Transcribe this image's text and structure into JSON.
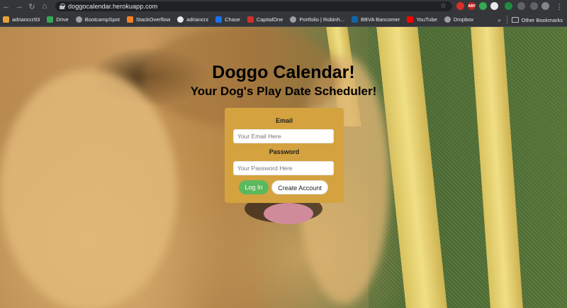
{
  "browser": {
    "url": "doggocalendar.herokuapp.com",
    "bookmarks": [
      {
        "label": "adriancrz93",
        "color": "#e8a23a"
      },
      {
        "label": "Drive",
        "color": "#34a853"
      },
      {
        "label": "BootcampSpot",
        "color": "#9aa0a6"
      },
      {
        "label": "StackOverflow",
        "color": "#f48024"
      },
      {
        "label": "adriancrz",
        "color": "#e8eaed"
      },
      {
        "label": "Chase",
        "color": "#1a73e8"
      },
      {
        "label": "CapitalOne",
        "color": "#d03027"
      },
      {
        "label": "Portfolio | Robinh...",
        "color": "#9aa0a6"
      },
      {
        "label": "BBVA Bancomer",
        "color": "#1464a5"
      },
      {
        "label": "YouTube",
        "color": "#ff0000"
      },
      {
        "label": "Dropbox",
        "color": "#9aa0a6"
      }
    ],
    "other_bookmarks": "Other Bookmarks"
  },
  "page": {
    "title": "Doggo Calendar!",
    "subtitle": "Your Dog's Play Date Scheduler!",
    "form": {
      "email_label": "Email",
      "email_placeholder": "Your Email Here",
      "password_label": "Password",
      "password_placeholder": "Your Password Here",
      "login_label": "Log In",
      "create_label": "Create Account"
    },
    "colors": {
      "card": "#d4a23f",
      "login_button": "#5cb85c"
    }
  }
}
